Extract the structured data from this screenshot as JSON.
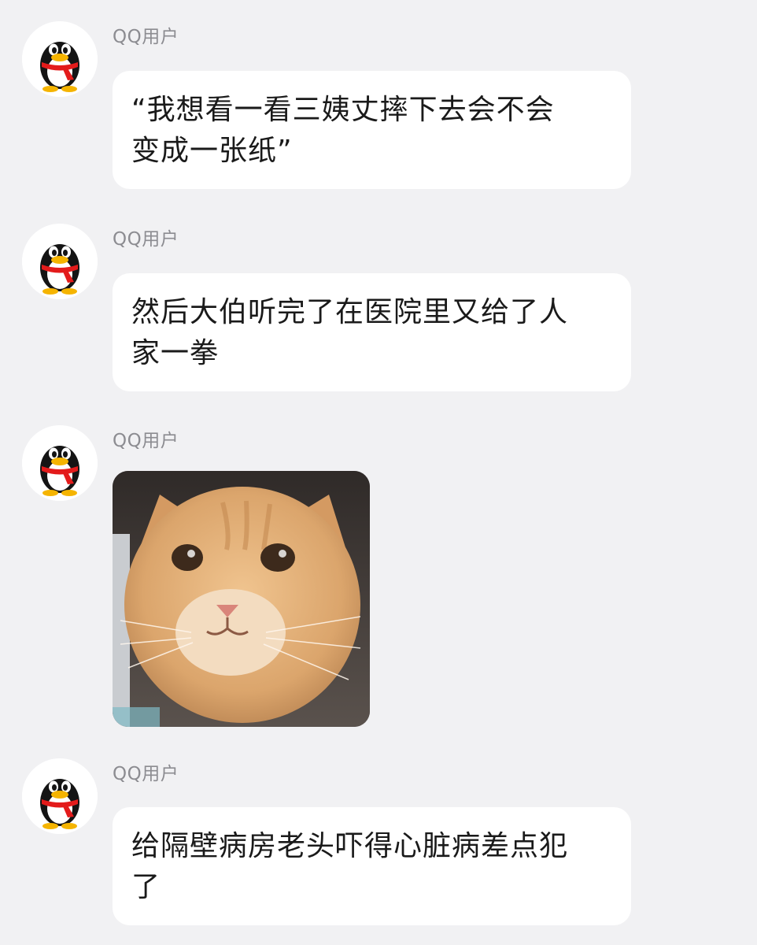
{
  "colors": {
    "background": "#f1f1f3",
    "bubble": "#ffffff",
    "sender_name": "#8c8c91",
    "message_text": "#1a1a1a"
  },
  "messages": [
    {
      "sender": "QQ用户",
      "avatar_icon": "qq-penguin-icon",
      "type": "text",
      "text": "“我想看一看三姨丈摔下去会不会\n变成一张纸”"
    },
    {
      "sender": "QQ用户",
      "avatar_icon": "qq-penguin-icon",
      "type": "text",
      "text": "然后大伯听完了在医院里又给了人\n家一拳"
    },
    {
      "sender": "QQ用户",
      "avatar_icon": "qq-penguin-icon",
      "type": "image",
      "image_subject": "orange-cat-meme"
    },
    {
      "sender": "QQ用户",
      "avatar_icon": "qq-penguin-icon",
      "type": "text",
      "text": "给隔壁病房老头吓得心脏病差点犯\n了"
    }
  ]
}
